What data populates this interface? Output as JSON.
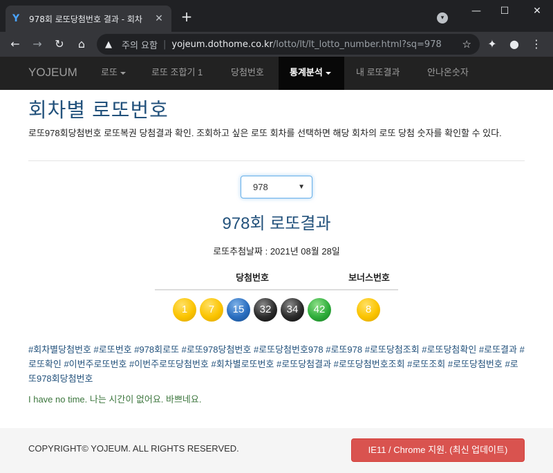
{
  "browser": {
    "tab_title": "978회 로또당첨번호 결과 - 회차",
    "favicon": "Y",
    "url_security": "주의 요함",
    "url_host": "yojeum.dothome.co.kr",
    "url_path": "/lotto/lt/lt_lotto_number.html?sq=978"
  },
  "navbar": {
    "brand": "YOJEUM",
    "items": [
      {
        "label": "로또",
        "dropdown": true
      },
      {
        "label": "로또 조합기 1"
      },
      {
        "label": "당첨번호"
      },
      {
        "label": "통계분석",
        "dropdown": true,
        "active": true
      },
      {
        "label": "내 로또결과"
      },
      {
        "label": "안나온숫자"
      }
    ]
  },
  "main": {
    "title": "회차별 로또번호",
    "description": "로또978회당첨번호 로또복권 당첨결과 확인. 조회하고 싶은 로또 회차를 선택하면 해당 회차의 로또 당첨 숫자를 확인할 수 있다.",
    "select_value": "978",
    "result_title": "978회 로또결과",
    "draw_date": "로또추첨날짜 : 2021년 08월 28일",
    "header_winning": "당첨번호",
    "header_bonus": "보너스번호",
    "winning_numbers": [
      {
        "value": "1",
        "color": "yellow"
      },
      {
        "value": "7",
        "color": "yellow"
      },
      {
        "value": "15",
        "color": "blue"
      },
      {
        "value": "32",
        "color": "black"
      },
      {
        "value": "34",
        "color": "black"
      },
      {
        "value": "42",
        "color": "green"
      }
    ],
    "bonus_number": {
      "value": "8",
      "color": "yellow"
    },
    "tags": "#회차별당첨번호 #로또번호 #978회로또 #로또978당첨번호 #로또당첨번호978 #로또978 #로또당첨조회 #로또당첨확인 #로또결과 #로또확인 #이번주로또번호 #이번주로또당첨번호 #회차별로또번호 #로또당첨결과 #로또당첨번호조회 #로또조회 #로또당첨번호 #로또978회당첨번호",
    "note": "I have no time. 나는 시간이 없어요. 바쁘네요."
  },
  "footer": {
    "copyright": "COPYRIGHT© YOJEUM. ALL RIGHTS RESERVED.",
    "button": "IE11 / Chrome 지원. (최신 업데이트)"
  },
  "colors": {
    "link": "#23527c",
    "navbar_bg": "#222222",
    "footer_button": "#d9534f"
  }
}
